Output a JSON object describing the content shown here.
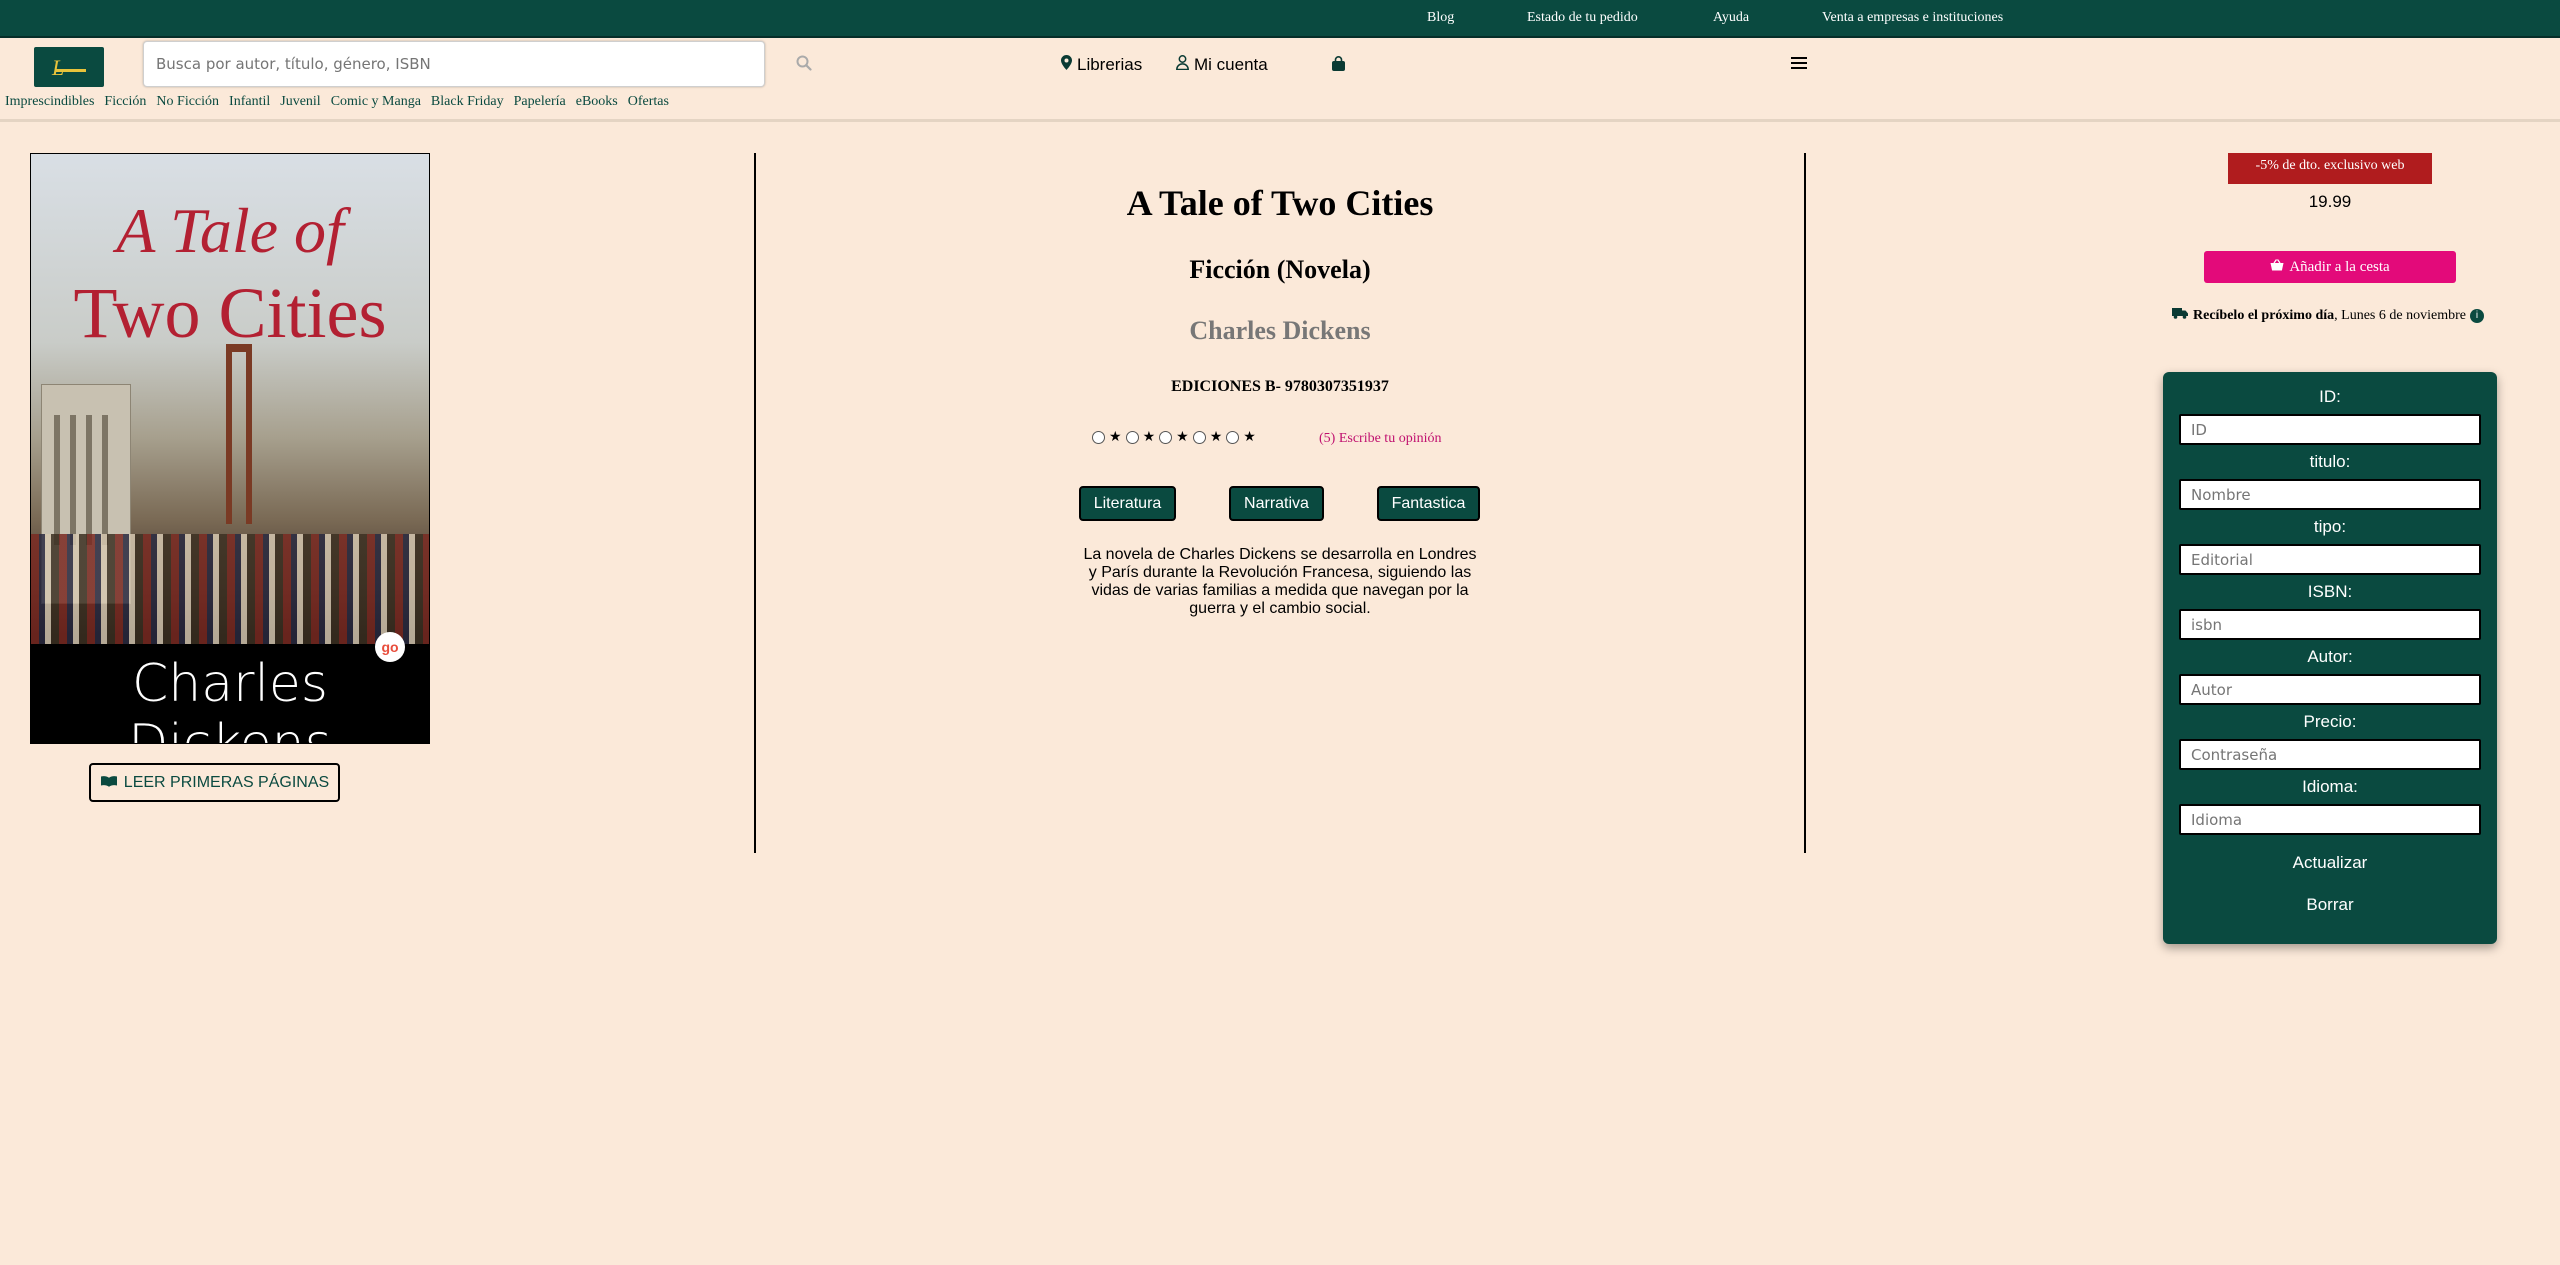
{
  "topbar": {
    "links": [
      "Blog",
      "Estado de tu pedido",
      "Ayuda",
      "Venta a empresas e instituciones"
    ]
  },
  "header": {
    "search_placeholder": "Busca por autor, título, género, ISBN",
    "stores_label": "Librerias",
    "account_label": "Mi cuenta"
  },
  "categories": [
    "Imprescindibles",
    "Ficción",
    "No Ficción",
    "Infantil",
    "Juvenil",
    "Comic y Manga",
    "Black Friday",
    "Papelería",
    "eBooks",
    "Ofertas"
  ],
  "cover": {
    "title_line1": "A Tale of",
    "title_line2": "Two Cities",
    "author": "Charles Dickens",
    "badge": "go"
  },
  "read_button_label": "LEER PRIMERAS PÁGINAS",
  "book": {
    "title": "A Tale of Two Cities",
    "genre": "Ficción (Novela)",
    "author": "Charles Dickens",
    "publisher_line": "EDICIONES B- 9780307351937",
    "rating_options": 5,
    "opinion_link": "(5) Escribe tu opinión",
    "tags": [
      "Literatura",
      "Narrativa",
      "Fantastica"
    ],
    "description": "La novela de Charles Dickens se desarrolla en Londres y París durante la Revolución Francesa, siguiendo las vidas de varias familias a medida que navegan por la guerra y el cambio social."
  },
  "purchase": {
    "discount": "-5% de dto. exclusivo web",
    "price": "19.99",
    "add_to_cart": "Añadir a la cesta",
    "delivery_bold": "Recíbelo el próximo día",
    "delivery_rest": ", Lunes 6 de noviembre"
  },
  "form": {
    "fields": [
      {
        "label": "ID:",
        "placeholder": "ID"
      },
      {
        "label": "titulo:",
        "placeholder": "Nombre"
      },
      {
        "label": "tipo:",
        "placeholder": "Editorial"
      },
      {
        "label": "ISBN:",
        "placeholder": "isbn"
      },
      {
        "label": "Autor:",
        "placeholder": "Autor"
      },
      {
        "label": "Precio:",
        "placeholder": "Contraseña"
      },
      {
        "label": "Idioma:",
        "placeholder": "Idioma"
      }
    ],
    "update_label": "Actualizar",
    "delete_label": "Borrar"
  },
  "colors": {
    "brand_green": "#0a4a40",
    "background": "#fbe9d9",
    "accent_pink": "#e30a7a",
    "discount_red": "#b01c1e"
  }
}
